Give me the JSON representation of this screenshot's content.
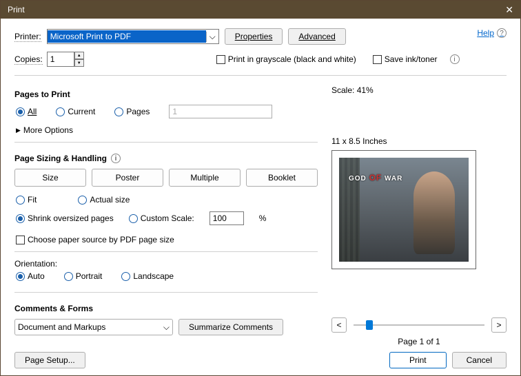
{
  "title": "Print",
  "help": "Help",
  "printer": {
    "label": "Printer:",
    "value": "Microsoft Print to PDF",
    "properties": "Properties",
    "advanced": "Advanced"
  },
  "copies": {
    "label": "Copies:",
    "value": "1"
  },
  "grayscale": "Print in grayscale (black and white)",
  "saveink": "Save ink/toner",
  "scale_label": "Scale:",
  "scale_value": "41%",
  "pages_to_print": {
    "title": "Pages to Print",
    "all": "All",
    "current": "Current",
    "pages": "Pages",
    "pages_value": "1",
    "more": "More Options"
  },
  "sizing": {
    "title": "Page Sizing & Handling",
    "size": "Size",
    "poster": "Poster",
    "multiple": "Multiple",
    "booklet": "Booklet",
    "fit": "Fit",
    "actual": "Actual size",
    "shrink": "Shrink oversized pages",
    "custom": "Custom Scale:",
    "custom_val": "100",
    "pct": "%",
    "choose_paper": "Choose paper source by PDF page size"
  },
  "orientation": {
    "title": "Orientation:",
    "auto": "Auto",
    "portrait": "Portrait",
    "landscape": "Landscape"
  },
  "comments": {
    "title": "Comments & Forms",
    "value": "Document and Markups",
    "summarize": "Summarize Comments"
  },
  "preview": {
    "dims": "11 x 8.5 Inches",
    "page": "Page 1 of 1"
  },
  "footer": {
    "page_setup": "Page Setup...",
    "print": "Print",
    "cancel": "Cancel"
  }
}
